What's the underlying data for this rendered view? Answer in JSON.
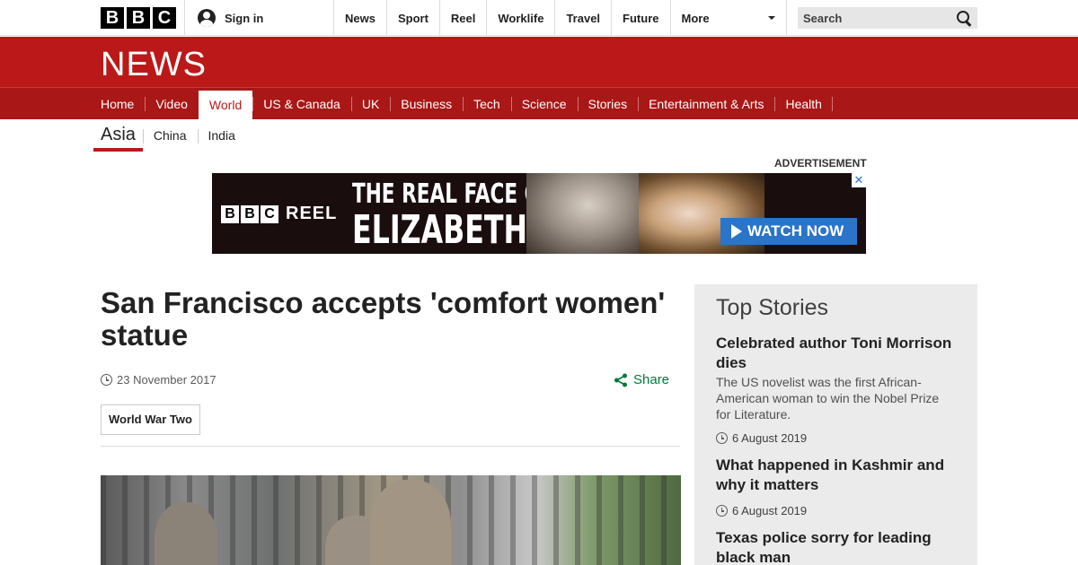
{
  "masthead": {
    "logo_letters": [
      "B",
      "B",
      "C"
    ],
    "signin_label": "Sign in",
    "nav": [
      "News",
      "Sport",
      "Reel",
      "Worklife",
      "Travel",
      "Future"
    ],
    "more_label": "More",
    "search_placeholder": "Search"
  },
  "newsband": {
    "logo_text": "NEWS"
  },
  "section_nav": {
    "items": [
      "Home",
      "Video",
      "World",
      "US & Canada",
      "UK",
      "Business",
      "Tech",
      "Science",
      "Stories",
      "Entertainment & Arts",
      "Health"
    ],
    "active": "World"
  },
  "sub_nav": {
    "active": "Asia",
    "items": [
      "China",
      "India"
    ]
  },
  "advertisement": {
    "label": "ADVERTISEMENT",
    "brand_letters": [
      "B",
      "B",
      "C"
    ],
    "brand_suffix": "REEL",
    "headline_line1": "THE REAL FACE OF",
    "headline_line2": "ELIZABETH I",
    "cta": "WATCH NOW",
    "close": "✕"
  },
  "article": {
    "headline": "San Francisco accepts 'comfort women' statue",
    "date": "23 November 2017",
    "share_label": "Share",
    "tag": "World War Two"
  },
  "sidebar": {
    "title": "Top Stories",
    "stories": [
      {
        "headline": "Celebrated author Toni Morrison dies",
        "summary": "The US novelist was the first African-American woman to win the Nobel Prize for Literature.",
        "date": "6 August 2019"
      },
      {
        "headline": "What happened in Kashmir and why it matters",
        "summary": "",
        "date": "6 August 2019"
      },
      {
        "headline": "Texas police sorry for leading black man",
        "summary": "",
        "date": ""
      }
    ]
  },
  "colors": {
    "brand_red": "#bb1919",
    "nav_red": "#a91717",
    "share_green": "#007a3d",
    "ad_cta_blue": "#2a74c9"
  }
}
